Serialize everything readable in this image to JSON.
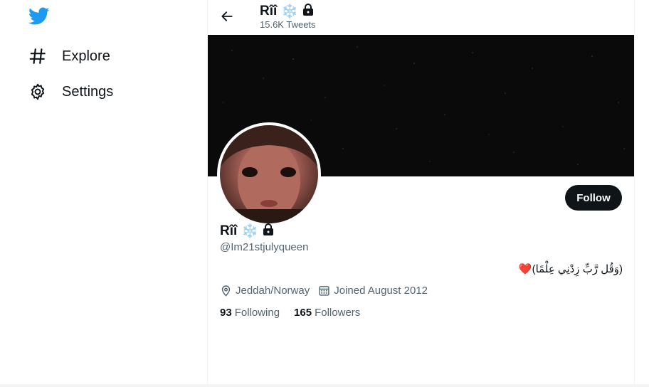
{
  "nav": {
    "logo_icon": "twitter-bird-icon",
    "items": [
      {
        "label": "Explore",
        "icon": "hashtag-icon"
      },
      {
        "label": "Settings",
        "icon": "gear-icon"
      }
    ]
  },
  "header": {
    "name": "Rîî",
    "tweets_count": "15.6K Tweets",
    "back_icon": "back-arrow-icon"
  },
  "profile": {
    "display_name": "Rîî",
    "name_emoji": "❄️",
    "handle": "@Im21stjulyqueen",
    "follow_label": "Follow",
    "bio_text": "(وَقُل رَّبِّ زِدْنِي عِلْمًا)",
    "bio_heart": "❤️",
    "location": "Jeddah/Norway",
    "joined": "Joined August 2012",
    "following_count": "93",
    "following_label": "Following",
    "followers_count": "165",
    "followers_label": "Followers"
  },
  "colors": {
    "brand": "#1d9bf0",
    "text": "#0f1419",
    "secondary": "#536471",
    "follow_bg": "#0f1419",
    "banner": "#0a0a0a"
  }
}
